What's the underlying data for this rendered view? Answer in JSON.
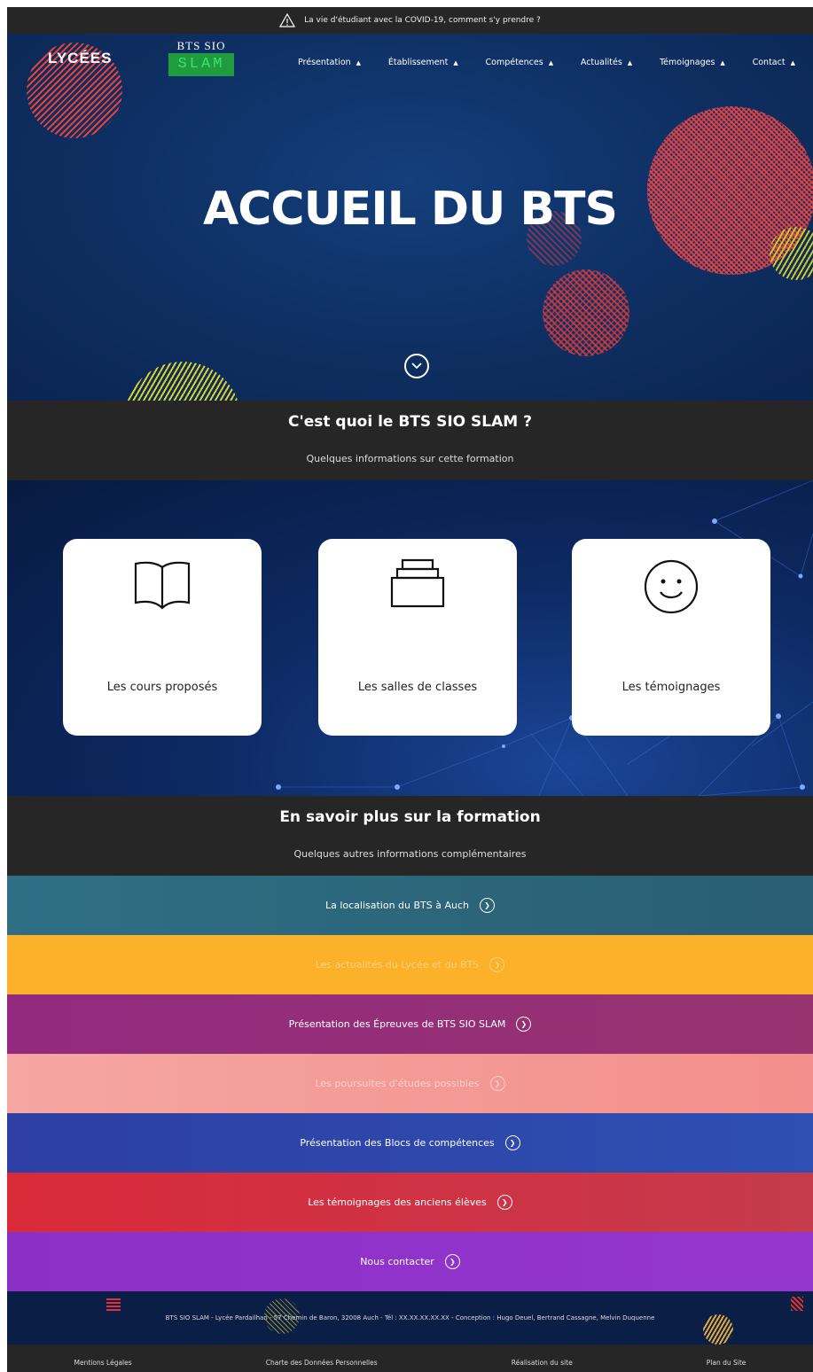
{
  "alert": {
    "text": "La vie d'étudiant avec la COVID-19, comment s'y prendre ?",
    "icon": "warning-icon"
  },
  "header": {
    "logo_lycees": "LYCÉES",
    "logo_bts_line1": "BTS SIO",
    "logo_bts_line2": "SLAM"
  },
  "nav": {
    "items": [
      {
        "label": "Présentation"
      },
      {
        "label": "Établissement"
      },
      {
        "label": "Compétences"
      },
      {
        "label": "Actualités"
      },
      {
        "label": "Témoignages"
      },
      {
        "label": "Contact"
      }
    ]
  },
  "hero": {
    "title": "ACCUEIL DU BTS"
  },
  "section1": {
    "title": "C'est quoi le BTS SIO SLAM ?",
    "subtitle": "Quelques informations sur cette formation"
  },
  "cards": [
    {
      "label": "Les cours proposés",
      "icon": "book-icon"
    },
    {
      "label": "Les salles de classes",
      "icon": "classroom-icon"
    },
    {
      "label": "Les témoignages",
      "icon": "smiley-icon"
    }
  ],
  "section2": {
    "title": "En savoir plus sur la formation",
    "subtitle": "Quelques autres informations complémentaires"
  },
  "bands": [
    {
      "label": "La localisation du BTS à Auch",
      "color": "#2e6f84"
    },
    {
      "label": "Les actualités du Lycée et du BTS",
      "color": "#fbb12a"
    },
    {
      "label": "Présentation des Épreuves de BTS SIO SLAM",
      "color": "#932a80"
    },
    {
      "label": "Les poursuites d'études possibles",
      "color": "#f5a6a0"
    },
    {
      "label": "Présentation des Blocs de compétences",
      "color": "#2d3fa3"
    },
    {
      "label": "Les témoignages des anciens élèves",
      "color": "#d92a3a"
    },
    {
      "label": "Nous contacter",
      "color": "#8b2fc7"
    }
  ],
  "footer": {
    "info": "BTS SIO SLAM - Lycée Pardailhan - 57 Chemin de Baron, 32008 Auch - Tél : XX.XX.XX.XX.XX - Conception : Hugo Deuel, Bertrand Cassagne, Melvin Duquenne",
    "links": [
      "Mentions Légales",
      "Charte des Données Personnelles",
      "Réalisation du site",
      "Plan du Site"
    ]
  }
}
